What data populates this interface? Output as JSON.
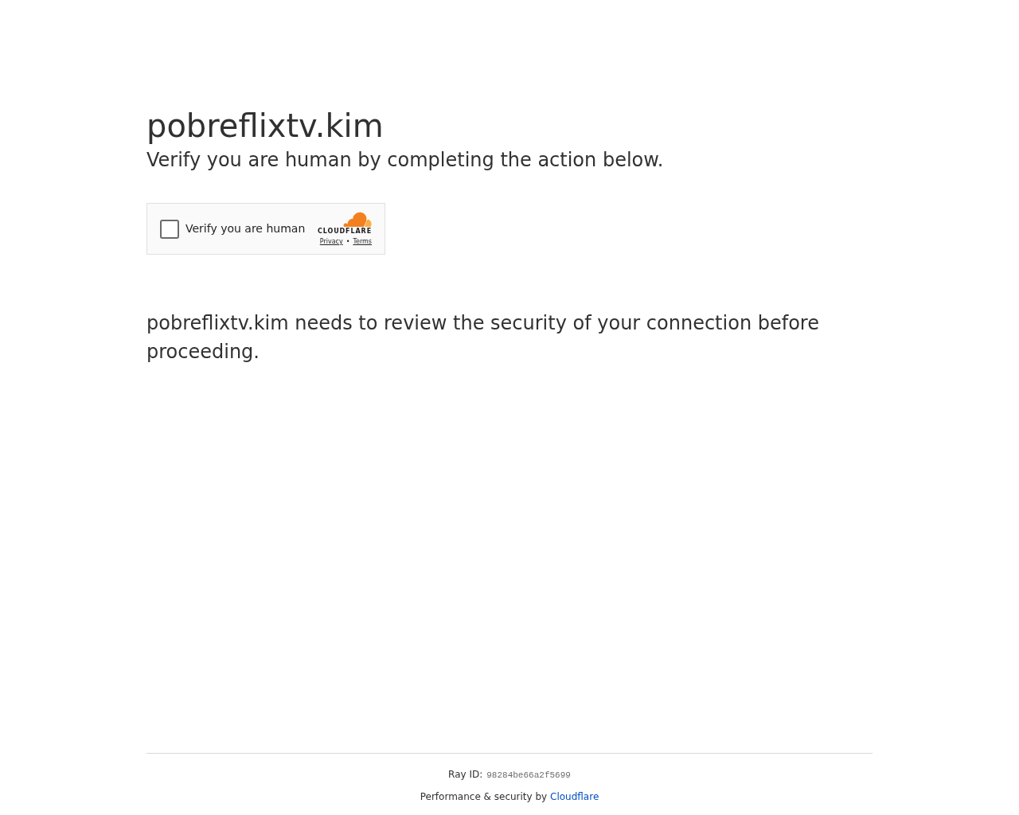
{
  "site": {
    "title": "pobreflixtv.kim",
    "subtitle": "Verify you are human by completing the action below."
  },
  "challenge": {
    "label": "Verify you are human",
    "checked": false,
    "brand": "CLOUDFLARE",
    "links": [
      "Privacy",
      "Terms"
    ],
    "separator": "•"
  },
  "message": "pobreflixtv.kim needs to review the security of your connection before proceeding.",
  "footer": {
    "ray_label": "Ray ID:",
    "ray_id": "98284be66a2f5699",
    "credit": "Performance & security by",
    "credit_link": "Cloudflare"
  }
}
